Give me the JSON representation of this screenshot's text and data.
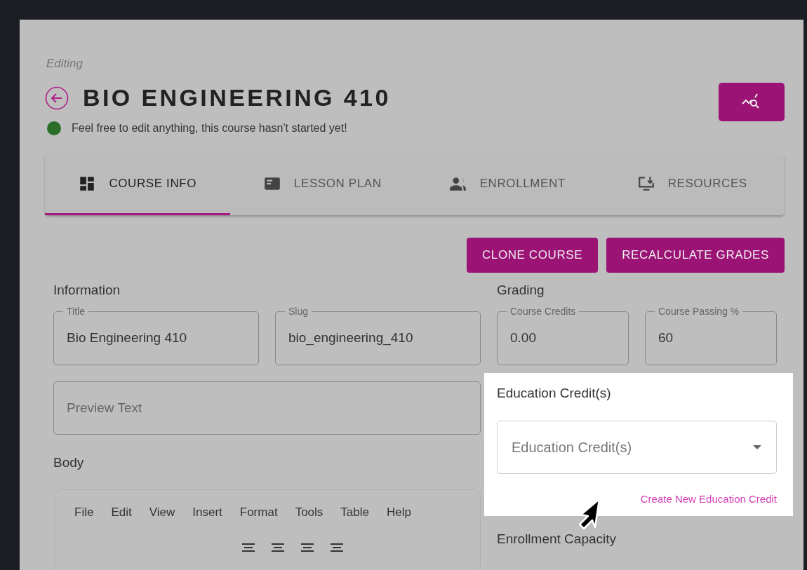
{
  "header": {
    "mode": "Editing",
    "title": "BIO ENGINEERING 410",
    "status": "Feel free to edit anything, this course hasn't started yet!"
  },
  "tabs": [
    {
      "label": "COURSE INFO",
      "kind": "dashboard",
      "selected": true
    },
    {
      "label": "LESSON PLAN",
      "kind": "lesson",
      "selected": false
    },
    {
      "label": "ENROLLMENT",
      "kind": "people",
      "selected": false
    },
    {
      "label": "RESOURCES",
      "kind": "download",
      "selected": false
    }
  ],
  "actions": [
    "CLONE COURSE",
    "RECALCULATE GRADES"
  ],
  "information": {
    "heading": "Information",
    "fields": [
      {
        "label": "Title",
        "value": "Bio Engineering 410"
      },
      {
        "label": "Slug",
        "value": "bio_engineering_410"
      }
    ],
    "preview": {
      "placeholder": "Preview Text"
    },
    "body_label": "Body",
    "editor_menu": [
      "File",
      "Edit",
      "View",
      "Insert",
      "Format",
      "Tools",
      "Table",
      "Help"
    ]
  },
  "grading": {
    "heading": "Grading",
    "fields": [
      {
        "label": "Course Credits",
        "value": "0.00"
      },
      {
        "label": "Course Passing %",
        "value": "60"
      }
    ]
  },
  "education_credits": {
    "highlighted": true,
    "label": "Education Credit(s)",
    "select": {
      "placeholder": "Education Credit(s)"
    },
    "link": "Create New Education Credit"
  },
  "enrollment_capacity": {
    "label": "Enrollment Capacity"
  }
}
